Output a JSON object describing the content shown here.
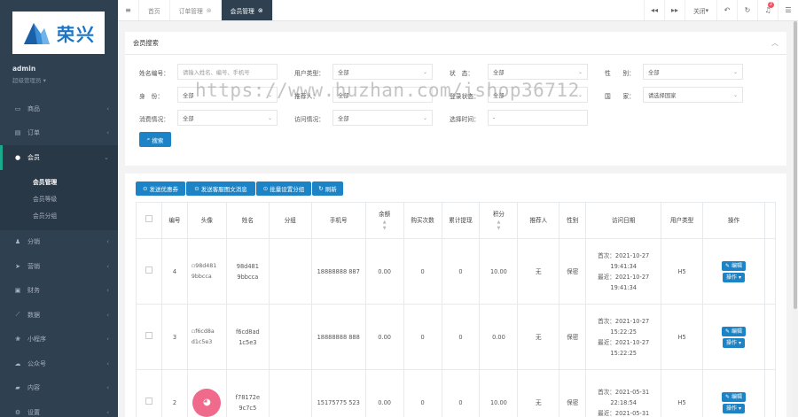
{
  "brand": {
    "logo_text": "荣兴",
    "logo_color": "#1a75c9"
  },
  "user": {
    "name": "admin",
    "role": "超级管理员"
  },
  "sidebar": {
    "items": [
      {
        "label": "商品",
        "icon": "monitor-icon",
        "glyph": "▭"
      },
      {
        "label": "订单",
        "icon": "clipboard-icon",
        "glyph": "▤"
      },
      {
        "label": "会员",
        "icon": "user-icon",
        "glyph": "●"
      },
      {
        "label": "分销",
        "icon": "users-icon",
        "glyph": "♟"
      },
      {
        "label": "营销",
        "icon": "send-icon",
        "glyph": "➤"
      },
      {
        "label": "财务",
        "icon": "money-icon",
        "glyph": "▣"
      },
      {
        "label": "数据",
        "icon": "chart-icon",
        "glyph": "⟋"
      },
      {
        "label": "小程序",
        "icon": "app-icon",
        "glyph": "❀"
      },
      {
        "label": "公众号",
        "icon": "wechat-icon",
        "glyph": "☁"
      },
      {
        "label": "内容",
        "icon": "folder-icon",
        "glyph": "▰"
      },
      {
        "label": "设置",
        "icon": "gear-icon",
        "glyph": "⚙"
      }
    ],
    "sub_items": [
      "会员管理",
      "会员等级",
      "会员分组"
    ]
  },
  "tabs": [
    {
      "label": "首页"
    },
    {
      "label": "订单管理"
    },
    {
      "label": "会员管理"
    }
  ],
  "topbar": {
    "close_label": "关闭",
    "notif_count": "2"
  },
  "search": {
    "title": "会员搜索",
    "labels": {
      "keyword": "姓名编号：",
      "user_type": "用户类型：",
      "status": "状　态：",
      "gender": "性　　别：",
      "identity": "身　份：",
      "rec": "推荐人：",
      "login": "登录状态：",
      "country": "国　　家：",
      "consume": "消费情况：",
      "visit": "访问情况：",
      "time": "选择时间："
    },
    "values": {
      "keyword_placeholder": "请输入姓名、编号、手机号",
      "user_type": "全部",
      "status": "全部",
      "gender": "全部",
      "identity": "全部",
      "rec": "全部",
      "login": "全部",
      "country": "请选择国家",
      "consume": "全部",
      "visit": "全部",
      "time": "-"
    },
    "search_btn": "搜索"
  },
  "watermark": "https://www.huzhan.com/ishop36712",
  "actions": [
    "发送优惠券",
    "发送客服图文消息",
    "批量设置分组",
    "刷新"
  ],
  "table": {
    "headers": [
      "",
      "编号",
      "头像",
      "姓名",
      "分组",
      "手机号",
      "余额",
      "购买次数",
      "累计提现",
      "积分",
      "推荐人",
      "性别",
      "访问日期",
      "用户类型",
      "操作"
    ],
    "rows": [
      {
        "id": "4",
        "avatar": "98d481 9bbcca",
        "name": "98d481 9bbcca",
        "group": "",
        "phone": "18888888 887",
        "balance": "0.00",
        "buys": "0",
        "withdraw": "0",
        "points": "10.00",
        "ref": "无",
        "gender": "保密",
        "first": "首次：2021-10-27 19:41:34",
        "last": "最近：2021-10-27 19:41:34",
        "type": "H5"
      },
      {
        "id": "3",
        "avatar": "f6cd8a d1c5e3",
        "name": "f6cd8ad 1c5e3",
        "group": "",
        "phone": "18888888 888",
        "balance": "0.00",
        "buys": "0",
        "withdraw": "0",
        "points": "0.00",
        "ref": "无",
        "gender": "保密",
        "first": "首次：2021-10-27 15:22:25",
        "last": "最近：2021-10-27 15:22:25",
        "type": "H5"
      },
      {
        "id": "2",
        "avatar": "",
        "name": "f78172e 9c7c5",
        "group": "",
        "phone": "15175775 523",
        "balance": "0.00",
        "buys": "0",
        "withdraw": "0",
        "points": "10.00",
        "ref": "无",
        "gender": "保密",
        "first": "首次：2021-05-31 22:18:54",
        "last": "最近：2021-05-31",
        "type": "H5"
      }
    ],
    "edit_label": "编辑",
    "op_label": "操作"
  }
}
